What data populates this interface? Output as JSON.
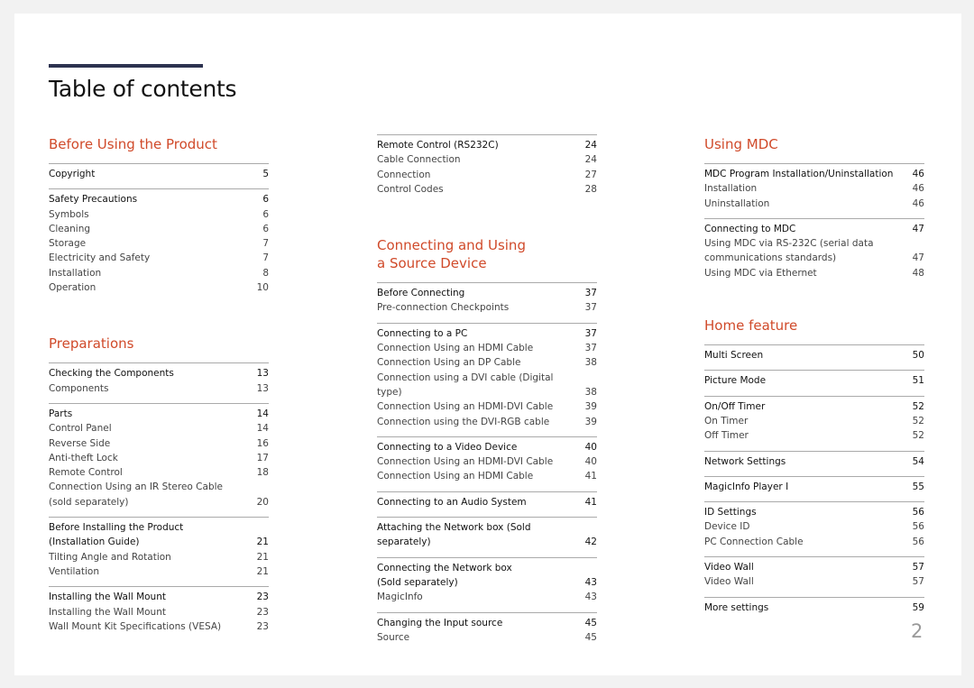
{
  "page_title": "Table of contents",
  "page_number": "2",
  "colors": {
    "heading": "#d04a2a",
    "title_bar": "#2d3350",
    "divider": "#aaaaaa"
  },
  "columns": [
    {
      "sections": [
        {
          "title": "Before Using the Product",
          "groups": [
            {
              "items": [
                {
                  "label": "Copyright",
                  "page": "5",
                  "level": "main"
                }
              ]
            },
            {
              "items": [
                {
                  "label": "Safety Precautions",
                  "page": "6",
                  "level": "main"
                },
                {
                  "label": "Symbols",
                  "page": "6",
                  "level": "sub"
                },
                {
                  "label": "Cleaning",
                  "page": "6",
                  "level": "sub"
                },
                {
                  "label": "Storage",
                  "page": "7",
                  "level": "sub"
                },
                {
                  "label": "Electricity and Safety",
                  "page": "7",
                  "level": "sub"
                },
                {
                  "label": "Installation",
                  "page": "8",
                  "level": "sub"
                },
                {
                  "label": "Operation",
                  "page": "10",
                  "level": "sub"
                }
              ]
            }
          ]
        },
        {
          "title": "Preparations",
          "groups": [
            {
              "items": [
                {
                  "label": "Checking the Components",
                  "page": "13",
                  "level": "main"
                },
                {
                  "label": "Components",
                  "page": "13",
                  "level": "sub"
                }
              ]
            },
            {
              "items": [
                {
                  "label": "Parts",
                  "page": "14",
                  "level": "main"
                },
                {
                  "label": "Control Panel",
                  "page": "14",
                  "level": "sub"
                },
                {
                  "label": "Reverse Side",
                  "page": "16",
                  "level": "sub"
                },
                {
                  "label": "Anti-theft Lock",
                  "page": "17",
                  "level": "sub"
                },
                {
                  "label": "Remote Control",
                  "page": "18",
                  "level": "sub"
                },
                {
                  "label": "Connection Using an IR Stereo Cable\n(sold separately)",
                  "page": "20",
                  "level": "sub"
                }
              ]
            },
            {
              "items": [
                {
                  "label": "Before Installing the Product\n(Installation Guide)",
                  "page": "21",
                  "level": "main"
                },
                {
                  "label": "Tilting Angle and Rotation",
                  "page": "21",
                  "level": "sub"
                },
                {
                  "label": "Ventilation",
                  "page": "21",
                  "level": "sub"
                }
              ]
            },
            {
              "items": [
                {
                  "label": "Installing the Wall Mount",
                  "page": "23",
                  "level": "main"
                },
                {
                  "label": "Installing the Wall Mount",
                  "page": "23",
                  "level": "sub"
                },
                {
                  "label": "Wall Mount Kit Specifications (VESA)",
                  "page": "23",
                  "level": "sub"
                }
              ]
            }
          ]
        }
      ]
    },
    {
      "sections": [
        {
          "title": "",
          "groups": [
            {
              "items": [
                {
                  "label": "Remote Control (RS232C)",
                  "page": "24",
                  "level": "main"
                },
                {
                  "label": "Cable Connection",
                  "page": "24",
                  "level": "sub"
                },
                {
                  "label": "Connection",
                  "page": "27",
                  "level": "sub"
                },
                {
                  "label": "Control Codes",
                  "page": "28",
                  "level": "sub"
                }
              ]
            }
          ]
        },
        {
          "title": "Connecting and Using\na Source Device",
          "groups": [
            {
              "items": [
                {
                  "label": "Before Connecting",
                  "page": "37",
                  "level": "main"
                },
                {
                  "label": "Pre-connection Checkpoints",
                  "page": "37",
                  "level": "sub"
                }
              ]
            },
            {
              "items": [
                {
                  "label": "Connecting to a PC",
                  "page": "37",
                  "level": "main"
                },
                {
                  "label": "Connection Using an HDMI Cable",
                  "page": "37",
                  "level": "sub"
                },
                {
                  "label": "Connection Using an DP Cable",
                  "page": "38",
                  "level": "sub"
                },
                {
                  "label": "Connection using a DVI cable (Digital type)",
                  "page": "38",
                  "level": "sub"
                },
                {
                  "label": "Connection Using an HDMI-DVI Cable",
                  "page": "39",
                  "level": "sub"
                },
                {
                  "label": "Connection using the DVI-RGB cable",
                  "page": "39",
                  "level": "sub"
                }
              ]
            },
            {
              "items": [
                {
                  "label": "Connecting to a Video Device",
                  "page": "40",
                  "level": "main"
                },
                {
                  "label": "Connection Using an HDMI-DVI Cable",
                  "page": "40",
                  "level": "sub"
                },
                {
                  "label": "Connection Using an HDMI Cable",
                  "page": "41",
                  "level": "sub"
                }
              ]
            },
            {
              "items": [
                {
                  "label": "Connecting to an Audio System",
                  "page": "41",
                  "level": "main"
                }
              ]
            },
            {
              "items": [
                {
                  "label": "Attaching the Network box (Sold separately)",
                  "page": "42",
                  "level": "main"
                }
              ]
            },
            {
              "items": [
                {
                  "label": "Connecting the Network box\n(Sold separately)",
                  "page": "43",
                  "level": "main"
                },
                {
                  "label": "MagicInfo",
                  "page": "43",
                  "level": "sub"
                }
              ]
            },
            {
              "items": [
                {
                  "label": "Changing the Input source",
                  "page": "45",
                  "level": "main"
                },
                {
                  "label": "Source",
                  "page": "45",
                  "level": "sub"
                }
              ]
            }
          ]
        }
      ]
    },
    {
      "sections": [
        {
          "title": "Using MDC",
          "groups": [
            {
              "items": [
                {
                  "label": "MDC Program Installation/Uninstallation",
                  "page": "46",
                  "level": "main"
                },
                {
                  "label": "Installation",
                  "page": "46",
                  "level": "sub"
                },
                {
                  "label": "Uninstallation",
                  "page": "46",
                  "level": "sub"
                }
              ]
            },
            {
              "items": [
                {
                  "label": "Connecting to MDC",
                  "page": "47",
                  "level": "main"
                },
                {
                  "label": "Using MDC via RS-232C (serial data\ncommunications standards)",
                  "page": "47",
                  "level": "sub"
                },
                {
                  "label": "Using MDC via Ethernet",
                  "page": "48",
                  "level": "sub"
                }
              ]
            }
          ]
        },
        {
          "title": "Home feature",
          "groups": [
            {
              "items": [
                {
                  "label": "Multi Screen",
                  "page": "50",
                  "level": "main"
                }
              ]
            },
            {
              "items": [
                {
                  "label": "Picture Mode",
                  "page": "51",
                  "level": "main"
                }
              ]
            },
            {
              "items": [
                {
                  "label": "On/Off Timer",
                  "page": "52",
                  "level": "main"
                },
                {
                  "label": "On Timer",
                  "page": "52",
                  "level": "sub"
                },
                {
                  "label": "Off Timer",
                  "page": "52",
                  "level": "sub"
                }
              ]
            },
            {
              "items": [
                {
                  "label": "Network Settings",
                  "page": "54",
                  "level": "main"
                }
              ]
            },
            {
              "items": [
                {
                  "label": "MagicInfo Player I",
                  "page": "55",
                  "level": "main"
                }
              ]
            },
            {
              "items": [
                {
                  "label": "ID Settings",
                  "page": "56",
                  "level": "main"
                },
                {
                  "label": "Device ID",
                  "page": "56",
                  "level": "sub"
                },
                {
                  "label": "PC Connection Cable",
                  "page": "56",
                  "level": "sub"
                }
              ]
            },
            {
              "items": [
                {
                  "label": "Video Wall",
                  "page": "57",
                  "level": "main"
                },
                {
                  "label": "Video Wall",
                  "page": "57",
                  "level": "sub"
                }
              ]
            },
            {
              "items": [
                {
                  "label": "More settings",
                  "page": "59",
                  "level": "main"
                }
              ]
            }
          ]
        }
      ]
    }
  ]
}
